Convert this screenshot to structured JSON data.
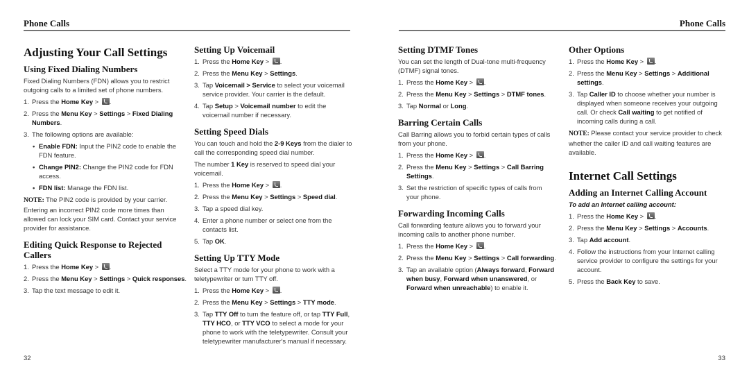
{
  "left_page": {
    "running_head": "Phone Calls",
    "page_number": "32",
    "col1": {
      "title": "Adjusting Your Call Settings",
      "fdn": {
        "heading": "Using Fixed Dialing Numbers",
        "intro": "Fixed Dialing Numbers (FDN) allows you to restrict outgoing calls to a limited set of phone numbers.",
        "step1_pre": "Press the ",
        "step1_key": "Home Key",
        "step1_sep": " > ",
        "step2_pre": "Press the ",
        "step2_a": "Menu Key",
        "step2_b": "Settings",
        "step2_c": "Fixed Dialing Numbers",
        "step3": "The following options are available:",
        "options": [
          {
            "label": "Enable FDN:",
            "text": " Input the PIN2 code to enable the FDN feature."
          },
          {
            "label": "Change PIN2:",
            "text": " Change the PIN2 code for FDN access."
          },
          {
            "label": "FDN list:",
            "text": " Manage the FDN list."
          }
        ],
        "note_label": "NOTE:",
        "note_text": " The PIN2 code is provided by your carrier. Entering an incorrect PIN2 code more times than allowed can lock your SIM card. Contact your service provider for assistance."
      },
      "quick": {
        "heading": "Editing Quick Response to Rejected Callers",
        "step1_pre": "Press the ",
        "step1_key": "Home Key",
        "step2_pre": "Press the ",
        "step2_a": "Menu Key",
        "step2_b": "Settings",
        "step2_c": "Quick responses",
        "step3": "Tap the text message to edit it."
      }
    },
    "col2": {
      "voicemail": {
        "heading": "Setting Up Voicemail",
        "step1_pre": "Press the ",
        "step1_key": "Home Key",
        "step2_pre": "Press the ",
        "step2_a": "Menu Key",
        "step2_b": "Settings",
        "step3_pre": "Tap ",
        "step3_a": "Voicemail > Service",
        "step3_post": " to select your voicemail service provider. Your carrier is the default.",
        "step4_pre": "Tap ",
        "step4_a": "Setup",
        "step4_b": "Voicemail number",
        "step4_post": " to edit the voicemail number if necessary."
      },
      "speed": {
        "heading": "Setting Speed Dials",
        "intro_pre": "You can touch and hold the ",
        "intro_key": "2-9 Keys",
        "intro_post": " from the dialer to call the corresponding speed dial number.",
        "intro2_pre": "The number ",
        "intro2_key": "1 Key",
        "intro2_post": " is reserved to speed dial your voicemail.",
        "step1_pre": "Press the ",
        "step1_key": "Home Key",
        "step2_pre": "Press the ",
        "step2_a": "Menu Key",
        "step2_b": "Settings",
        "step2_c": "Speed dial",
        "step3": "Tap a speed dial key.",
        "step4": "Enter a phone number or select one from the contacts list.",
        "step5_pre": "Tap ",
        "step5_a": "OK"
      },
      "tty": {
        "heading": "Setting Up TTY Mode",
        "intro": "Select a TTY mode for your phone to work with a teletypewriter or turn TTY off.",
        "step1_pre": "Press the ",
        "step1_key": "Home Key",
        "step2_pre": "Press the ",
        "step2_a": "Menu Key",
        "step2_b": "Settings",
        "step2_c": "TTY mode",
        "step3_pre": "Tap ",
        "step3_a": "TTY Off",
        "step3_b": " to turn the feature off, or tap ",
        "step3_c": "TTY Full",
        "step3_d": "TTY HCO",
        "step3_e": ", or ",
        "step3_f": "TTY VCO",
        "step3_post": " to select a mode for your phone to work with the teletypewriter. Consult your teletypewriter manufacturer's manual if necessary."
      }
    }
  },
  "right_page": {
    "running_head": "Phone Calls",
    "page_number": "33",
    "col3": {
      "dtmf": {
        "heading": "Setting DTMF Tones",
        "intro": "You can set the length of Dual-tone multi-frequency (DTMF) signal tones.",
        "step1_pre": "Press the ",
        "step1_key": "Home Key",
        "step2_pre": "Press the ",
        "step2_a": "Menu Key",
        "step2_b": "Settings",
        "step2_c": "DTMF tones",
        "step3_pre": "Tap ",
        "step3_a": "Normal",
        "step3_b": " or ",
        "step3_c": "Long"
      },
      "barring": {
        "heading": "Barring Certain Calls",
        "intro": "Call Barring allows you to forbid certain types of calls from your phone.",
        "step1_pre": "Press the ",
        "step1_key": "Home Key",
        "step2_pre": "Press the ",
        "step2_a": "Menu Key",
        "step2_b": "Settings",
        "step2_c": "Call Barring Settings",
        "step3": "Set the restriction of specific types of calls from your phone."
      },
      "forwarding": {
        "heading": "Forwarding Incoming Calls",
        "intro": "Call forwarding feature allows you to forward your incoming calls to another phone number.",
        "step1_pre": "Press the ",
        "step1_key": "Home Key",
        "step2_pre": "Press the ",
        "step2_a": "Menu Key",
        "step2_b": "Settings",
        "step2_c": "Call forwarding",
        "step3_pre": "Tap an available option (",
        "step3_a": "Always forward",
        "step3_b": "Forward when busy",
        "step3_c": "Forward when unanswered",
        "step3_or": ", or ",
        "step3_d": "Forward when unreachable",
        "step3_post": ") to enable it."
      }
    },
    "col4": {
      "other": {
        "heading": "Other Options",
        "step1_pre": "Press the ",
        "step1_key": "Home Key",
        "step2_pre": "Press the ",
        "step2_a": "Menu Key",
        "step2_b": "Settings",
        "step2_c": "Additional settings",
        "step3_pre": "Tap ",
        "step3_a": "Caller ID",
        "step3_b": " to choose whether your number is displayed when someone receives your outgoing call. Or check ",
        "step3_c": "Call waiting",
        "step3_post": " to get notified of incoming calls during a call.",
        "note_label": "NOTE:",
        "note_text": " Please contact your service provider to check whether the caller ID and call waiting features are available."
      },
      "internet": {
        "title": "Internet Call Settings",
        "heading": "Adding an Internet Calling Account",
        "subheading": "To add an Internet calling account:",
        "step1_pre": "Press the ",
        "step1_key": "Home Key",
        "step2_pre": "Press the ",
        "step2_a": "Menu Key",
        "step2_b": "Settings",
        "step2_c": "Accounts",
        "step3_pre": "Tap ",
        "step3_a": "Add account",
        "step4": "Follow the instructions from your Internet calling service provider to configure the settings for your account.",
        "step5_pre": "Press the ",
        "step5_a": "Back Key",
        "step5_post": " to save."
      }
    }
  },
  "common": {
    "gt": " > ",
    "period": ".",
    "comma": ", ",
    "n1": "1.",
    "n2": "2.",
    "n3": "3.",
    "n4": "4.",
    "n5": "5.",
    "bullet": "•"
  }
}
